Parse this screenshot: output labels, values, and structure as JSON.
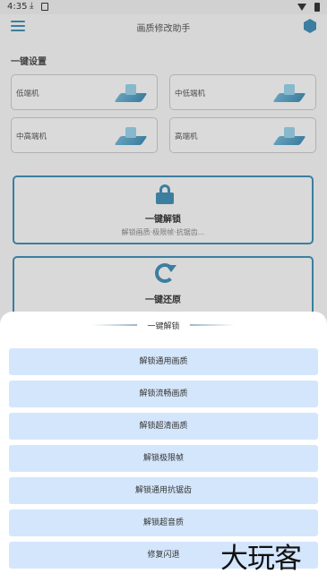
{
  "status_bar": {
    "time": "4:35",
    "icons": [
      "download-icon",
      "app-notification-icon",
      "wifi-icon",
      "battery-icon"
    ]
  },
  "app_bar": {
    "title": "画质修改助手",
    "left_icon": "menu-icon",
    "right_icon": "hexagon-icon"
  },
  "settings": {
    "section_title": "一键设置",
    "devices": [
      {
        "label": "低端机",
        "icon": "chip-icon"
      },
      {
        "label": "中低端机",
        "icon": "chip-icon"
      },
      {
        "label": "中高端机",
        "icon": "chip-icon"
      },
      {
        "label": "高端机",
        "icon": "chip-icon"
      }
    ]
  },
  "cards": {
    "unlock": {
      "title": "一键解锁",
      "subtitle": "解锁画质·极限帧·抗锯齿...",
      "icon": "lock-icon"
    },
    "restore": {
      "title": "一键还原",
      "icon": "refresh-icon"
    }
  },
  "sheet": {
    "title": "一键解锁",
    "options": [
      "解锁通用画质",
      "解锁流畅画质",
      "解锁超清画质",
      "解锁极限帧",
      "解锁通用抗锯齿",
      "解锁超音质",
      "修复闪退"
    ]
  },
  "watermark": "大玩客",
  "colors": {
    "accent": "#2f7fa8",
    "option_bg": "#d4e6fb",
    "sheet_bg": "#ffffff",
    "page_bg": "#ececec"
  }
}
